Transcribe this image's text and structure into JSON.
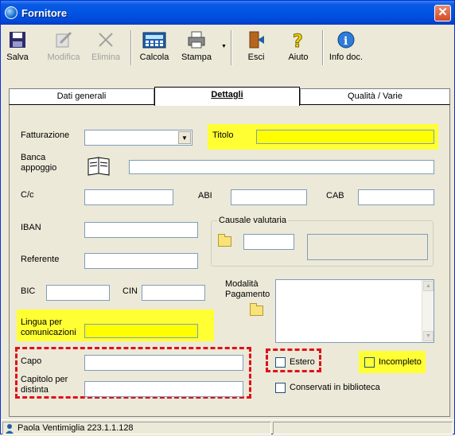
{
  "window": {
    "title": "Fornitore",
    "close_glyph": "✕"
  },
  "toolbar": {
    "salva": "Salva",
    "modifica": "Modifica",
    "elimina": "Elimina",
    "calcola": "Calcola",
    "stampa": "Stampa",
    "esci": "Esci",
    "aiuto": "Aiuto",
    "info": "Info doc."
  },
  "tabs": [
    {
      "label": "Dati generali"
    },
    {
      "label": "Dettagli"
    },
    {
      "label": "Qualità / Varie"
    }
  ],
  "form": {
    "fatturazione_label": "Fatturazione",
    "fatturazione_value": "",
    "titolo_label": "Titolo",
    "titolo_value": "",
    "banca_label": "Banca appoggio",
    "banca_value": "",
    "cc_label": "C/c",
    "cc_value": "",
    "abi_label": "ABI",
    "abi_value": "",
    "cab_label": "CAB",
    "cab_value": "",
    "iban_label": "IBAN",
    "iban_value": "",
    "causale_label": "Causale valutaria",
    "causale_code": "",
    "causale_desc": "",
    "referente_label": "Referente",
    "referente_value": "",
    "bic_label": "BIC",
    "bic_value": "",
    "cin_label": "CIN",
    "cin_value": "",
    "modalita_label": "Modalità Pagamento",
    "modalita_value": "",
    "lingua_label": "Lingua per comunicazioni",
    "lingua_value": "",
    "capo_label": "Capo",
    "capo_value": "",
    "capitolo_label": "Capitolo per distinta",
    "capitolo_value": "",
    "estero_label": "Estero",
    "incompleto_label": "Incompleto",
    "conservati_label": "Conservati in biblioteca"
  },
  "status": {
    "user": "Paola Ventimiglia 223.1.1.128"
  },
  "colors": {
    "highlight": "#FFFF33",
    "annotation": "#E0101A",
    "titlebar": "#0054E3"
  }
}
